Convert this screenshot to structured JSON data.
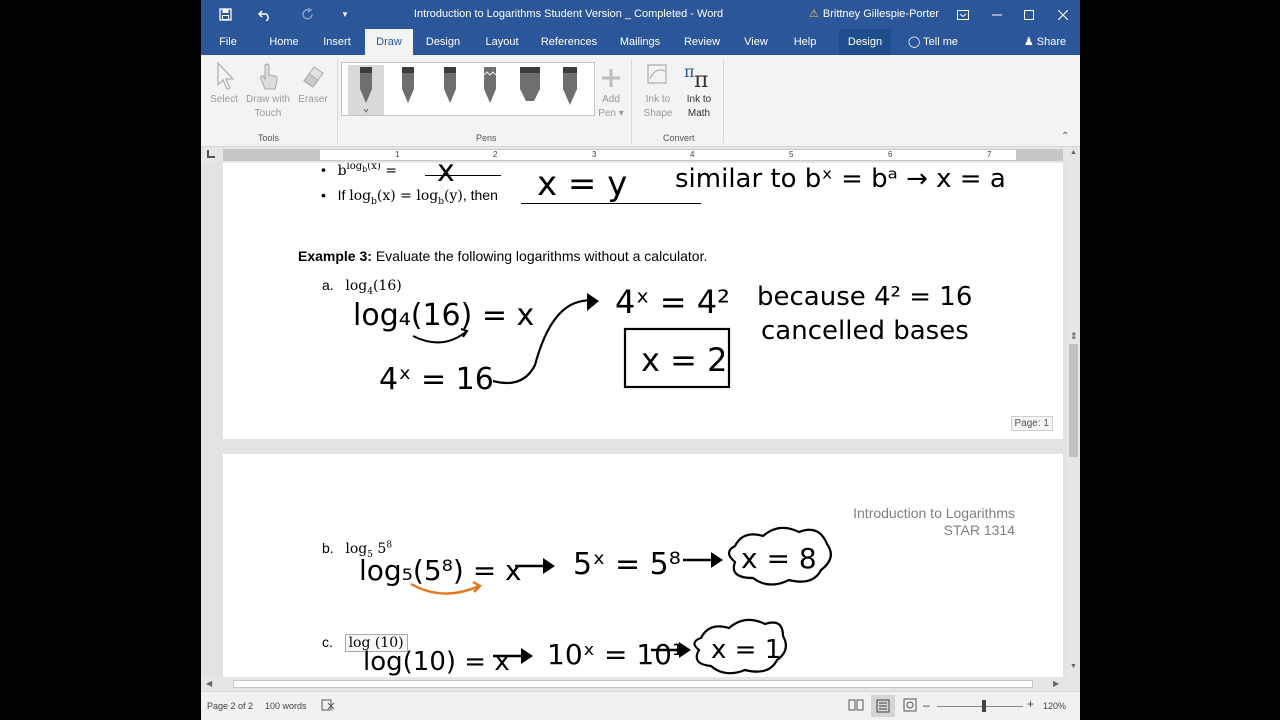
{
  "titlebar": {
    "doc_title": "Introduction to Logarithms Student Version _ Completed  -  Word",
    "user": "Brittney Gillespie-Porter",
    "warning_icon": "warning-icon"
  },
  "tabs": [
    "File",
    "Home",
    "Insert",
    "Draw",
    "Design",
    "Layout",
    "References",
    "Mailings",
    "Review",
    "View",
    "Help",
    "Design"
  ],
  "tell_me": "Tell me",
  "share": "Share",
  "ribbon": {
    "select": "Select",
    "draw_touch_1": "Draw with",
    "draw_touch_2": "Touch",
    "eraser": "Eraser",
    "tools_label": "Tools",
    "pens_label": "Pens",
    "add_pen_1": "Add",
    "add_pen_2": "Pen",
    "ink_shape_1": "Ink to",
    "ink_shape_2": "Shape",
    "ink_math_1": "Ink to",
    "ink_math_2": "Math",
    "convert_label": "Convert"
  },
  "ruler_numbers": [
    "1",
    "2",
    "3",
    "4",
    "5",
    "6",
    "7"
  ],
  "page1": {
    "bullet2_if": "If",
    "bullet2_then": ", then",
    "example_label": "Example 3:",
    "example_text": "Evaluate the following logarithms without a calculator.",
    "item_a": "a.",
    "ink": {
      "x_blank": "x",
      "x_eq_y": "x = y",
      "similar": "similar to  bˣ = bᵃ  →  x = a",
      "eq1": "log₄(16) = x",
      "eq2": "4ˣ = 16",
      "eq3": "4ˣ = 4²",
      "boxed": "x = 2",
      "because": "because  4² = 16",
      "cancelled": "cancelled bases"
    },
    "page_badge": "Page: 1"
  },
  "page2": {
    "header_title": "Introduction to Logarithms",
    "header_course": "STAR 1314",
    "item_b": "b.",
    "item_c": "c.",
    "ink": {
      "b_eq": "log₅(5⁸) = x",
      "b_mid": "5ˣ = 5⁸",
      "b_cloud": "x = 8",
      "c_eq": "log(10) = x",
      "c_mid": "10ˣ = 10¹",
      "c_cloud": "x = 1"
    }
  },
  "status": {
    "page": "Page 2 of 2",
    "words": "100 words",
    "zoom": "120%"
  },
  "colors": {
    "word_blue": "#2b579a",
    "ink_orange": "#e4761b"
  }
}
